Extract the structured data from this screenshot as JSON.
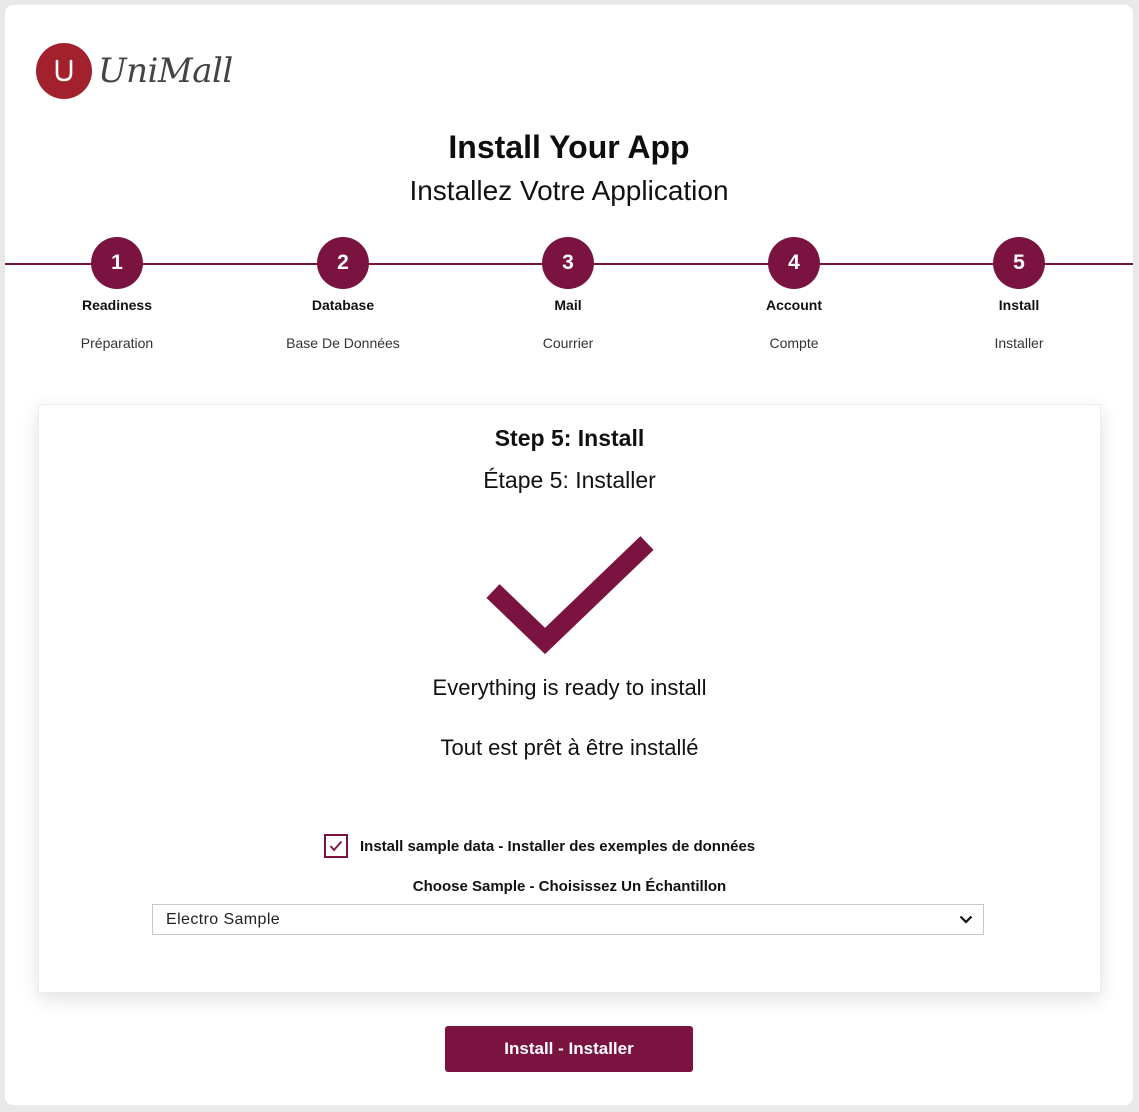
{
  "brand": {
    "name": "UniMall",
    "mark_letter": "U",
    "color": "#a3212d"
  },
  "header": {
    "title": "Install Your App",
    "subtitle": "Installez Votre Application"
  },
  "theme": {
    "accent": "#7b1340"
  },
  "stepper": {
    "current_step": 5,
    "steps": [
      {
        "number": "1",
        "label": "Readiness",
        "sub": "Préparation"
      },
      {
        "number": "2",
        "label": "Database",
        "sub": "Base De Données"
      },
      {
        "number": "3",
        "label": "Mail",
        "sub": "Courrier"
      },
      {
        "number": "4",
        "label": "Account",
        "sub": "Compte"
      },
      {
        "number": "5",
        "label": "Install",
        "sub": "Installer"
      }
    ]
  },
  "card": {
    "title": "Step 5: Install",
    "subtitle": "Étape 5: Installer",
    "status_icon": "checkmark-icon",
    "ready_en": "Everything is ready to install",
    "ready_fr": "Tout est prêt à être installé",
    "sample_checkbox": {
      "checked": true,
      "label": "Install sample data - Installer des exemples de données"
    },
    "choose_label": "Choose Sample - Choisissez Un Échantillon",
    "sample_select": {
      "value": "Electro Sample",
      "icon": "chevron-down-icon"
    }
  },
  "actions": {
    "install_label": "Install - Installer"
  }
}
